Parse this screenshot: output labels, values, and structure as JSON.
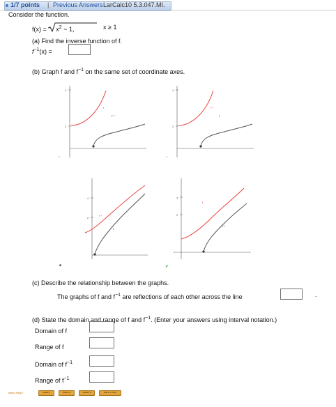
{
  "header": {
    "points": "1/7 points",
    "separator": "|",
    "previous_answers": "Previous Answers",
    "problem_code": "LarCalc10 5.3.047.MI."
  },
  "intro": "Consider the function.",
  "function": {
    "lhs": "f(x) =",
    "radicand_base": "x",
    "radicand_exp": "2",
    "radicand_rest": " − 1,",
    "domain": "x ≥ 1"
  },
  "part_a": {
    "prompt": "(a) Find the inverse function of f.",
    "label_base": "f",
    "label_sup": "−1",
    "label_rest": "(x) =",
    "answer": ""
  },
  "part_b": {
    "prompt_pre": "(b) Graph f and f",
    "prompt_sup": "−1",
    "prompt_post": " on the same set of coordinate axes."
  },
  "graphs": [
    {
      "ticks": [
        "4",
        "2"
      ],
      "labels": [
        "f",
        "f⁻¹"
      ],
      "choice_marker": "○"
    },
    {
      "ticks": [
        "4",
        "2"
      ],
      "labels": [
        "f⁻¹",
        "f"
      ],
      "choice_marker": "○"
    },
    {
      "ticks": [
        "4",
        "2"
      ],
      "labels": [
        "f⁻¹",
        "f"
      ],
      "choice_marker": "■"
    },
    {
      "ticks": [
        "4",
        "2"
      ],
      "labels": [
        "f",
        "f⁻¹"
      ],
      "choice_marker": "✔"
    }
  ],
  "part_c": {
    "prompt": "(c) Describe the relationship between the graphs.",
    "sentence_pre": "The graphs of f and f",
    "sentence_sup": "−1",
    "sentence_post": " are reflections of each other across the line",
    "end": ".",
    "answer": ""
  },
  "part_d": {
    "prompt_pre": "(d) State the domain and range of f and f",
    "prompt_sup": "−1",
    "prompt_post": ". (Enter your answers using interval notation.)",
    "fields": [
      {
        "label": "Domain of f",
        "sup": "",
        "answer": ""
      },
      {
        "label": "Range of f",
        "sup": "",
        "answer": ""
      },
      {
        "label": "Domain of f",
        "sup": "−1",
        "answer": ""
      },
      {
        "label": "Range of f",
        "sup": "−1",
        "answer": ""
      }
    ]
  },
  "help": {
    "label": "Need Help?",
    "buttons": [
      "Read It",
      "Watch It",
      "Master It",
      "Talk to a Tutor"
    ]
  },
  "colors": {
    "f_inverse_curve": "#e8433a",
    "f_curve": "#555555",
    "link": "#1c4fa0",
    "button": "#e2a53d"
  }
}
